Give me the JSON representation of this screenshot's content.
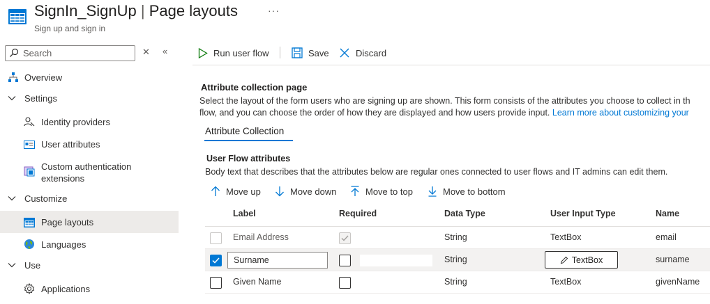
{
  "header": {
    "title": "SignIn_SignUp",
    "separator": "|",
    "page": "Page layouts",
    "subtitle": "Sign up and sign in",
    "more": "···"
  },
  "sidebar": {
    "search_placeholder": "Search",
    "items": [
      {
        "label": "Overview",
        "icon": "overview-icon"
      },
      {
        "label": "Settings",
        "icon": "chevron-down-icon"
      },
      {
        "label": "Identity providers",
        "icon": "identity-providers-icon"
      },
      {
        "label": "User attributes",
        "icon": "user-attributes-icon"
      },
      {
        "label": "Custom authentication",
        "label2": "extensions",
        "icon": "custom-extensions-icon"
      },
      {
        "label": "Customize",
        "icon": "chevron-down-icon"
      },
      {
        "label": "Page layouts",
        "icon": "page-layouts-icon",
        "active": true
      },
      {
        "label": "Languages",
        "icon": "globe-icon"
      },
      {
        "label": "Use",
        "icon": "chevron-down-icon"
      },
      {
        "label": "Applications",
        "icon": "gear-icon"
      }
    ]
  },
  "toolbar": {
    "run": "Run user flow",
    "save": "Save",
    "discard": "Discard"
  },
  "section": {
    "title": "Attribute collection page",
    "desc_line1": "Select the layout of the form users who are signing up are shown. This form consists of the attributes you choose to collect in th",
    "desc_line2": "flow, and you can choose the order of how they are displayed and how users provide input.",
    "learn_more": "Learn more about customizing your"
  },
  "tabs": {
    "attribute_collection": "Attribute Collection"
  },
  "user_flow": {
    "title": "User Flow attributes",
    "body": "Body text that describes that the attributes below are regular ones connected to user flows and IT admins can edit them."
  },
  "move": {
    "up": "Move up",
    "down": "Move down",
    "top": "Move to top",
    "bottom": "Move to bottom"
  },
  "table": {
    "columns": [
      "Label",
      "Required",
      "Data Type",
      "User Input Type",
      "Name"
    ],
    "rows": [
      {
        "label": "Email Address",
        "required": true,
        "data_type": "String",
        "input_type": "TextBox",
        "name": "email",
        "selected": false,
        "disabled": true
      },
      {
        "label": "Surname",
        "required": false,
        "data_type": "String",
        "input_type": "TextBox",
        "name": "surname",
        "selected": true,
        "disabled": false
      },
      {
        "label": "Given Name",
        "required": false,
        "data_type": "String",
        "input_type": "TextBox",
        "name": "givenName",
        "selected": false,
        "disabled": false
      }
    ]
  },
  "colors": {
    "accent": "#0078d4",
    "run_icon": "#107c10"
  }
}
